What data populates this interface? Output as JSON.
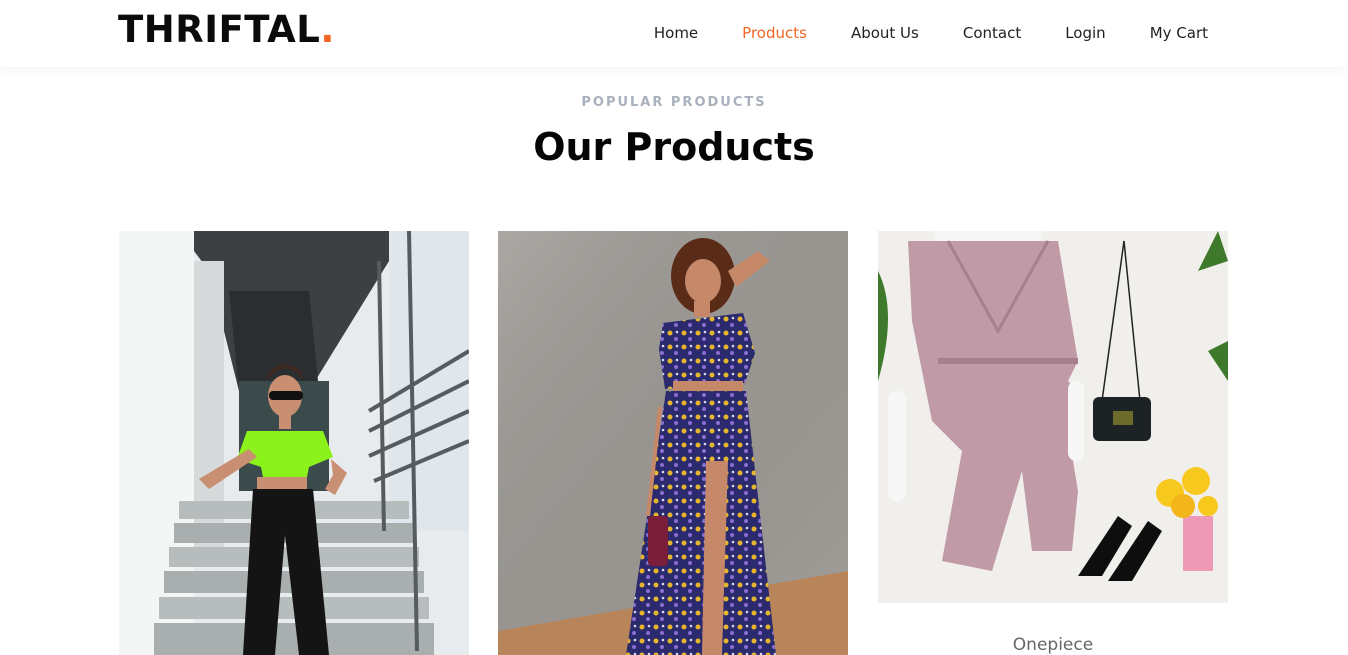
{
  "brand": {
    "name": "THRIFTAL",
    "dot": ".",
    "accent_color": "#f26522"
  },
  "nav": {
    "items": [
      {
        "label": "Home",
        "active": false
      },
      {
        "label": "Products",
        "active": true
      },
      {
        "label": "About Us",
        "active": false
      },
      {
        "label": "Contact",
        "active": false
      },
      {
        "label": "Login",
        "active": false
      },
      {
        "label": "My Cart",
        "active": false
      }
    ]
  },
  "section": {
    "eyebrow": "POPULAR PRODUCTS",
    "title": "Our Products"
  },
  "products": [
    {
      "image": "woman-neon-crop-top-photo",
      "name": ""
    },
    {
      "image": "woman-floral-maxi-dress-photo",
      "name": ""
    },
    {
      "image": "mauve-wrap-dress-mannequin-photo",
      "name": "Onepiece"
    }
  ]
}
